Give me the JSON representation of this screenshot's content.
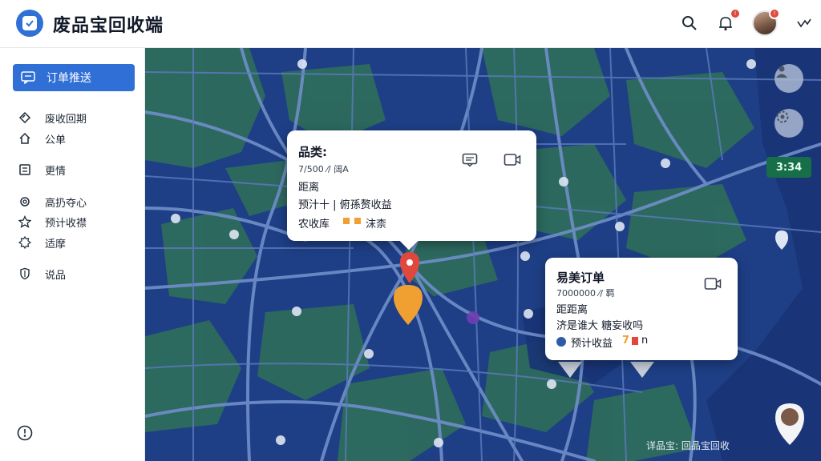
{
  "header": {
    "app_title": "废品宝回收端",
    "icons": [
      "search-icon",
      "bell-icon",
      "avatar",
      "trend-icon"
    ],
    "notification_badge": "!",
    "avatar_badge": "!"
  },
  "sidebar": {
    "active_item": "订单推送",
    "items": [
      {
        "label": "废收回期",
        "icon": "tag-icon"
      },
      {
        "label": "公单",
        "icon": "home-icon"
      },
      {
        "label": "更情",
        "icon": "list-icon"
      },
      {
        "label": "高扔夺心",
        "icon": "gear-icon"
      },
      {
        "label": "预计收襟",
        "icon": "star-icon"
      },
      {
        "label": "适摩",
        "icon": "gear-icon"
      },
      {
        "label": "说品",
        "icon": "shield-icon"
      }
    ]
  },
  "popup_main": {
    "title": "品类:",
    "price": "7/500 ⁄/ 阔A",
    "distance_label": "距离",
    "line3": "预汁十  |  俯孫赘收益",
    "line4_label": "农收库",
    "line4_value": "沫柰"
  },
  "popup_secondary": {
    "title": "易美订单",
    "price": "7000000 ⁄/ 羁",
    "distance_label": "距距离",
    "line3": "济是谁大 糖妄收吗",
    "income_label": "预计收益",
    "income_value": "7",
    "income_suffix": "n"
  },
  "map": {
    "time_badge": "3:34",
    "footer_text": "详品宝:  回品宝回收",
    "colors": {
      "water": "#1e3f86",
      "land": "#2d6b5c",
      "road": "#6f8ec9",
      "pin_red": "#e0483e",
      "pin_orange": "#f0a030"
    }
  }
}
